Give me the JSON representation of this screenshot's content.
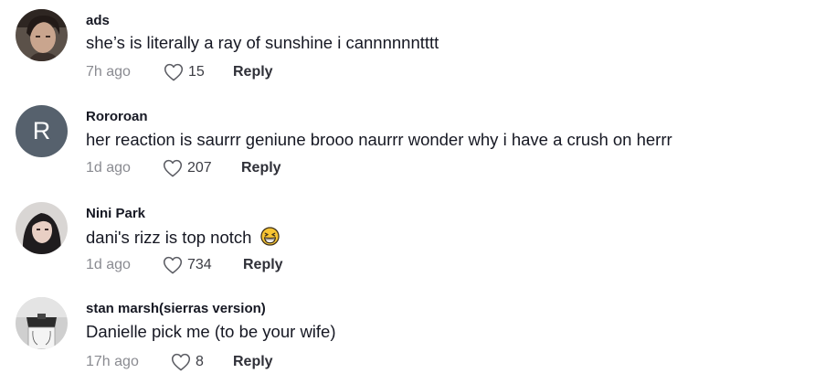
{
  "comments": [
    {
      "username": "ads",
      "text": "she’s is literally a ray of sunshine i cannnnnntttt",
      "time": "7h ago",
      "likes": "15",
      "reply": "Reply",
      "avatar_icon": "profile-photo-dark-hair"
    },
    {
      "username": "Rororoan",
      "text": "her reaction is saurrr geniune brooo naurrr wonder why i have a crush on herrr",
      "time": "1d ago",
      "likes": "207",
      "reply": "Reply",
      "avatar_letter": "R",
      "avatar_color": "#56616d"
    },
    {
      "username": "Nini Park",
      "text": "dani's rizz is top notch",
      "emoji": "grinning-squinting-face-emoji",
      "time": "1d ago",
      "likes": "734",
      "reply": "Reply",
      "avatar_icon": "profile-photo-girl"
    },
    {
      "username": "stan marsh(sierras version)",
      "text": "Danielle pick me (to be your wife)",
      "time": "17h ago",
      "likes": "8",
      "reply": "Reply",
      "avatar_icon": "profile-photo-bag"
    }
  ],
  "colors": {
    "text": "#161823",
    "secondary": "#8a8b91",
    "avatar_letter_bg": "#56616d"
  }
}
